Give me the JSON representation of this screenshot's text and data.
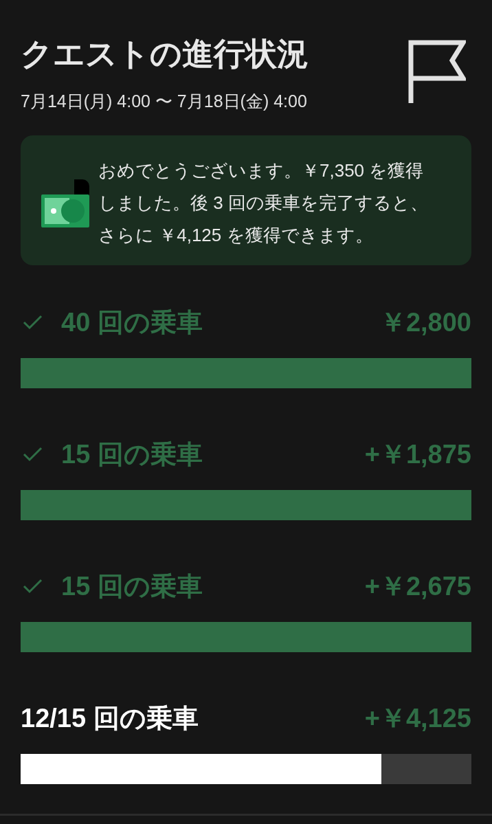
{
  "header": {
    "title": "クエストの進行状況",
    "period": "7月14日(月) 4:00 〜 7月18日(金) 4:00"
  },
  "banner": {
    "message": "おめでとうございます。￥7,350 を獲得しました。後 3 回の乗車を完了すると、さらに ￥4,125 を獲得できます。"
  },
  "milestones": [
    {
      "label": "40 回の乗車",
      "amount": "￥2,800",
      "completed": true,
      "level": 1
    },
    {
      "label": "15 回の乗車",
      "amount": "+￥1,875",
      "completed": true,
      "level": 1
    },
    {
      "label": "15 回の乗車",
      "amount": "+￥2,675",
      "completed": true,
      "level": 1
    },
    {
      "label": "12/15 回の乗車",
      "amount": "+￥4,125",
      "completed": false,
      "level": 0.8
    }
  ]
}
